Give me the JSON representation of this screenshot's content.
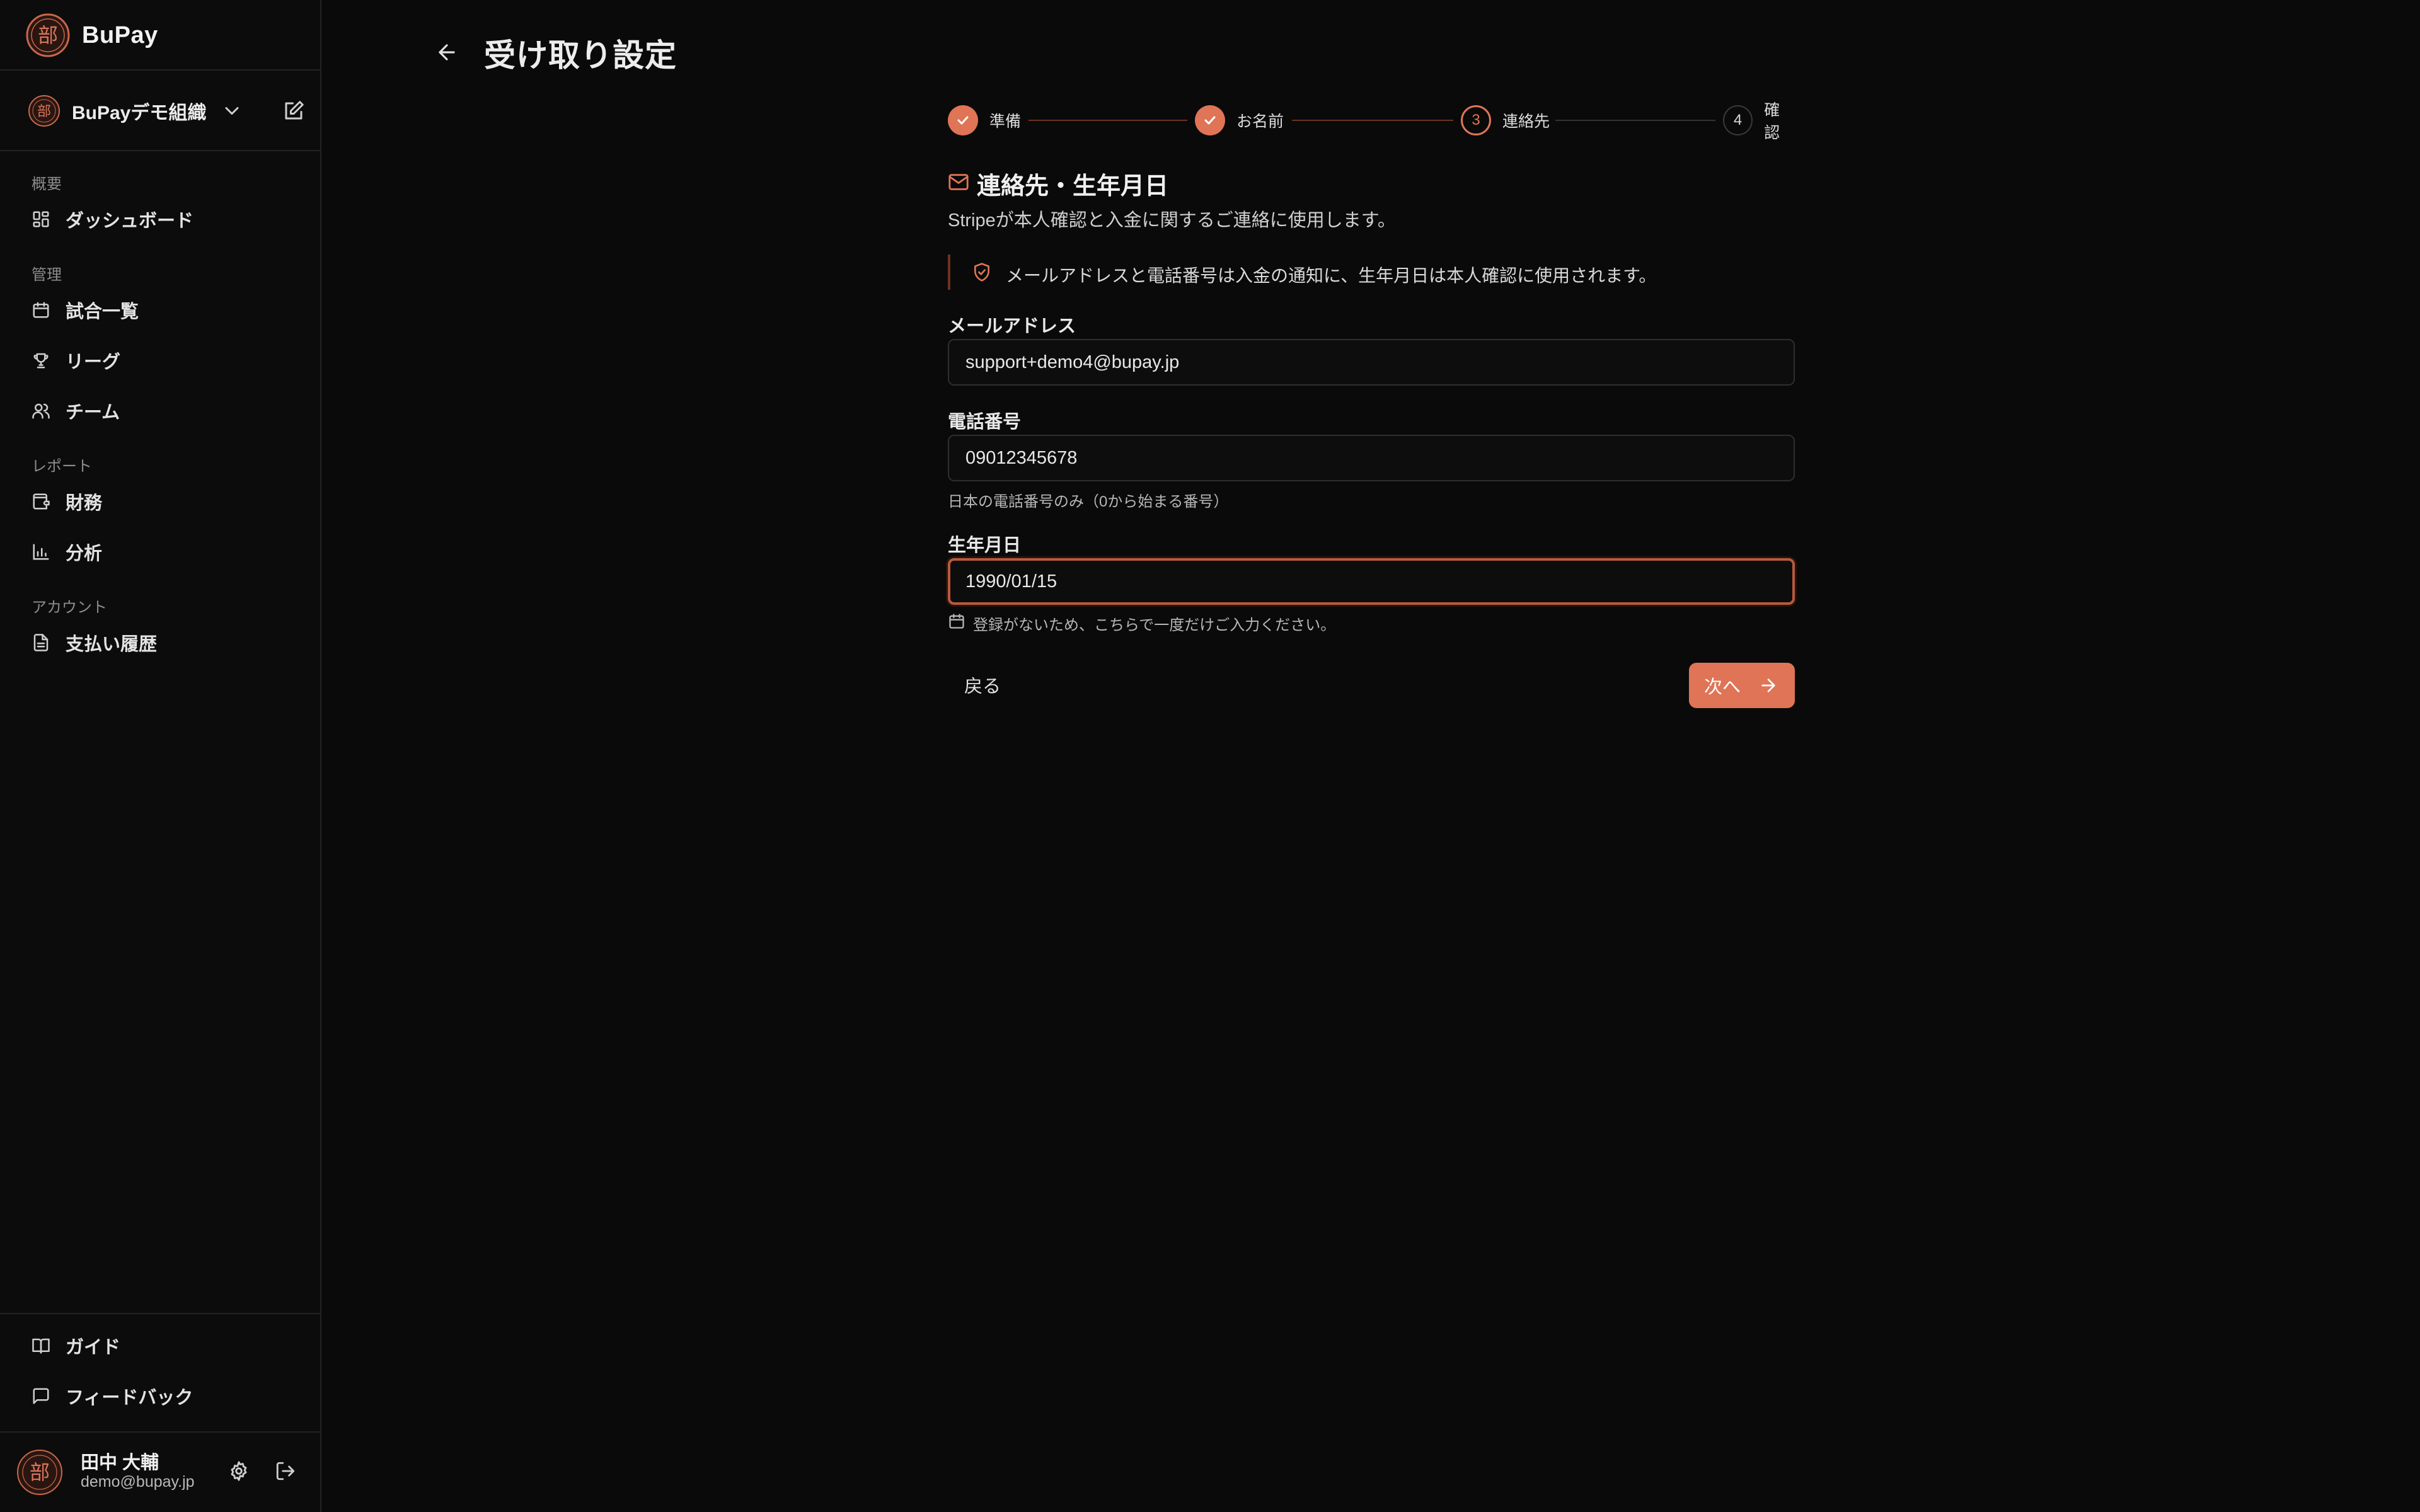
{
  "brand": {
    "name": "BuPay",
    "logo_char": "部"
  },
  "org": {
    "name": "BuPayデモ組織"
  },
  "sidebar": {
    "sections": [
      {
        "label": "概要",
        "items": [
          {
            "label": "ダッシュボード",
            "icon": "dashboard-icon"
          }
        ]
      },
      {
        "label": "管理",
        "items": [
          {
            "label": "試合一覧",
            "icon": "calendar-icon"
          },
          {
            "label": "リーグ",
            "icon": "trophy-icon"
          },
          {
            "label": "チーム",
            "icon": "users-icon"
          }
        ]
      },
      {
        "label": "レポート",
        "items": [
          {
            "label": "財務",
            "icon": "wallet-icon"
          },
          {
            "label": "分析",
            "icon": "bar-chart-icon"
          }
        ]
      },
      {
        "label": "アカウント",
        "items": [
          {
            "label": "支払い履歴",
            "icon": "document-icon"
          }
        ]
      }
    ],
    "footer_items": [
      {
        "label": "ガイド",
        "icon": "book-icon"
      },
      {
        "label": "フィードバック",
        "icon": "message-icon"
      }
    ]
  },
  "user": {
    "name": "田中 大輔",
    "email": "demo@bupay.jp"
  },
  "page": {
    "title": "受け取り設定"
  },
  "stepper": {
    "steps": [
      {
        "number": "1",
        "label": "準備",
        "state": "done"
      },
      {
        "number": "2",
        "label": "お名前",
        "state": "done"
      },
      {
        "number": "3",
        "label": "連絡先",
        "state": "current"
      },
      {
        "number": "4",
        "label": "確認",
        "state": "todo"
      }
    ]
  },
  "section": {
    "title": "連絡先・生年月日",
    "description": "Stripeが本人確認と入金に関するご連絡に使用します。",
    "notice": "メールアドレスと電話番号は入金の通知に、生年月日は本人確認に使用されます。"
  },
  "form": {
    "email": {
      "label": "メールアドレス",
      "value": "support+demo4@bupay.jp"
    },
    "phone": {
      "label": "電話番号",
      "value": "09012345678",
      "help": "日本の電話番号のみ（0から始まる番号）"
    },
    "birthdate": {
      "label": "生年月日",
      "value": "1990/01/15",
      "help": "登録がないため、こちらで一度だけご入力ください。"
    }
  },
  "actions": {
    "back_label": "戻る",
    "next_label": "次へ"
  },
  "colors": {
    "accent": "#df7556",
    "background": "#0a0a0a",
    "sidebar": "#0c0c0c"
  }
}
